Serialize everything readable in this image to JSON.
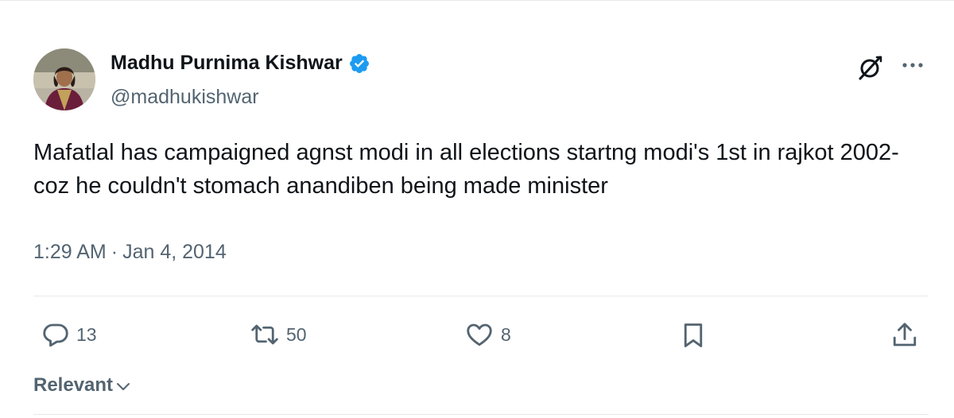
{
  "author": {
    "display_name": "Madhu Purnima Kishwar",
    "handle": "@madhukishwar",
    "verified": true
  },
  "tweet": {
    "text": "Mafatlal has campaigned agnst modi in all elections startng modi's 1st in rajkot 2002- coz he couldn't stomach anandiben being made minister",
    "time": "1:29 AM",
    "separator": "·",
    "date": "Jan 4, 2014"
  },
  "actions": {
    "replies": "13",
    "reposts": "50",
    "likes": "8"
  },
  "sort": {
    "label": "Relevant"
  },
  "icons": {
    "verified": "verified-badge-icon",
    "grok": "grok-icon",
    "more": "more-icon",
    "reply": "reply-icon",
    "repost": "repost-icon",
    "like": "heart-icon",
    "bookmark": "bookmark-icon",
    "share": "share-icon",
    "chevron": "chevron-down-icon"
  },
  "colors": {
    "text_primary": "#0f1419",
    "text_secondary": "#536471",
    "verified_blue": "#1d9bf0",
    "divider": "#e6e9eb"
  }
}
